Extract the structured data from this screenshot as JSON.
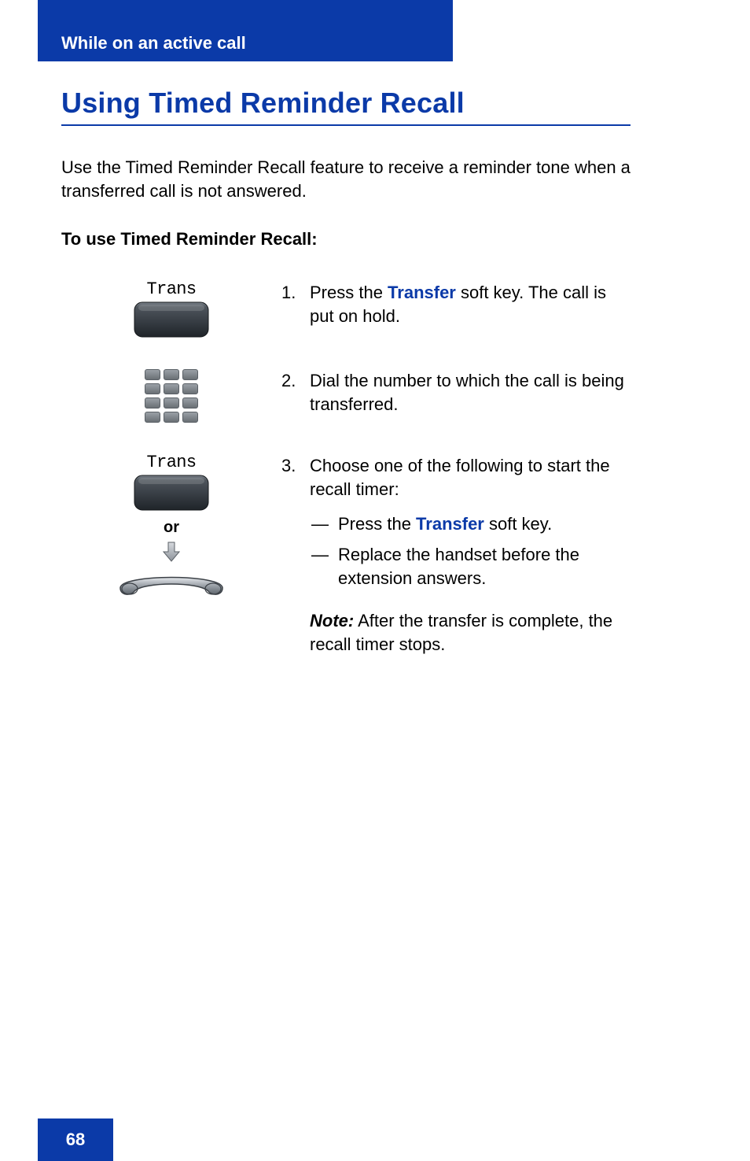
{
  "header": {
    "section_label": "While on an active call"
  },
  "title": "Using Timed Reminder Recall",
  "intro": "Use the Timed Reminder Recall feature to receive a reminder tone when a transferred call is not answered.",
  "subhead": "To use Timed Reminder Recall:",
  "steps": {
    "s1": {
      "icon_label": "Trans",
      "num": "1.",
      "text_before": "Press the ",
      "keyword": "Transfer",
      "text_after": " soft key. The call is put on hold."
    },
    "s2": {
      "num": "2.",
      "text": "Dial the number to which the call is being transferred."
    },
    "s3": {
      "icon_label": "Trans",
      "or_label": "or",
      "num": "3.",
      "text": "Choose one of the following to start the recall timer:",
      "sub1_before": "Press the ",
      "sub1_keyword": "Transfer",
      "sub1_after": " soft key.",
      "sub2": "Replace the handset before the extension answers.",
      "note_label": "Note:",
      "note_text": " After the transfer is complete, the recall timer stops."
    }
  },
  "footer": {
    "page_number": "68"
  }
}
